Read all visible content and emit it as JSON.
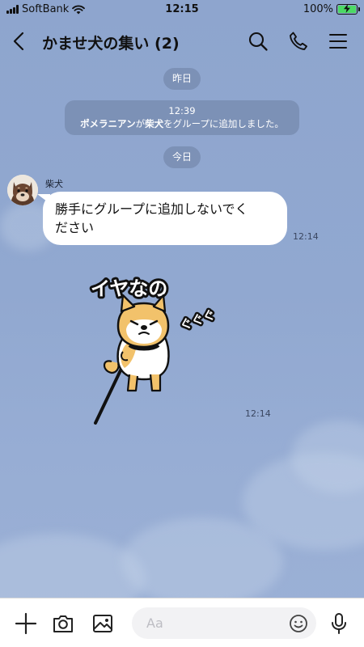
{
  "status_bar": {
    "carrier": "SoftBank",
    "time": "12:15",
    "battery_percent": "100%",
    "battery_level": 1.0,
    "charging": true
  },
  "header": {
    "title": "かませ犬の集い (2)",
    "icons": [
      "back-icon",
      "search-icon",
      "phone-icon",
      "menu-icon"
    ]
  },
  "messages": {
    "date_yesterday": "昨日",
    "system_time": "12:39",
    "system_actor": "ポメラニアン",
    "system_mid": "が",
    "system_target": "柴犬",
    "system_suffix": "をグループに追加しました。",
    "date_today": "今日",
    "sender_name": "柴犬",
    "text_line1": "勝手にグループに追加しないでく",
    "text_line2": "ださい",
    "text_time": "12:14",
    "sticker_caption": "イヤなの",
    "sticker_sfx": "ぐぐぐ",
    "sticker_time": "12:14"
  },
  "input": {
    "placeholder": "Aa",
    "value": ""
  },
  "toolbar_icons": [
    "plus-icon",
    "camera-icon",
    "image-icon",
    "emoji-icon",
    "microphone-icon"
  ]
}
